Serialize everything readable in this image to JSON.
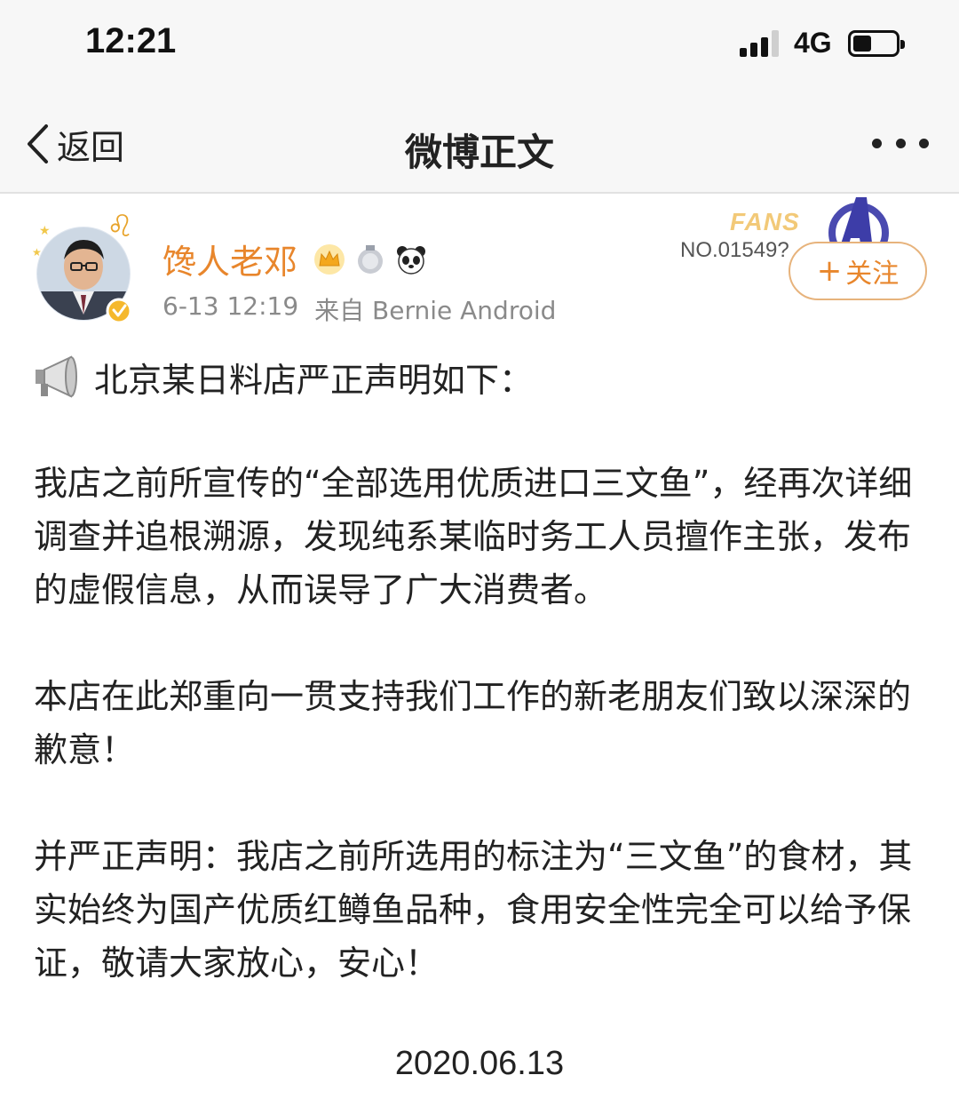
{
  "status_bar": {
    "time": "12:21",
    "network": "4G",
    "signal_bars_filled": 3,
    "battery_percent": 40
  },
  "nav": {
    "back_label": "返回",
    "title": "微博正文"
  },
  "post": {
    "author": "馋人老邓",
    "timestamp": "6-13 12:19",
    "source": "来自 Bernie Android",
    "fans_badge": {
      "word": "FANS",
      "number": "NO.01549?"
    },
    "follow_label": "关注",
    "headline": "北京某日料店严正声明如下：",
    "paragraphs": [
      "我店之前所宣传的“全部选用优质进口三文鱼”，经再次详细调查并追根溯源，发现纯系某临时务工人员擅作主张，发布的虚假信息，从而误导了广大消费者。",
      "本店在此郑重向一贯支持我们工作的新老朋友们致以深深的歉意！",
      "并严正声明：我店之前所选用的标注为“三文鱼”的食材，其实始终为国产优质红鳟鱼品种，食用安全性完全可以给予保证，敬请大家放心，安心！"
    ],
    "date": "2020.06.13"
  },
  "colors": {
    "author_name": "#e8862c",
    "meta_text": "#8a8a8a",
    "bar_bg": "#f7f7f7",
    "follow_border": "#e7b37c"
  },
  "icons": [
    "back-chevron-icon",
    "more-dots-icon",
    "crown-icon",
    "medal-icon",
    "panda-icon",
    "verified-icon",
    "megaphone-icon",
    "avengers-logo-icon"
  ]
}
